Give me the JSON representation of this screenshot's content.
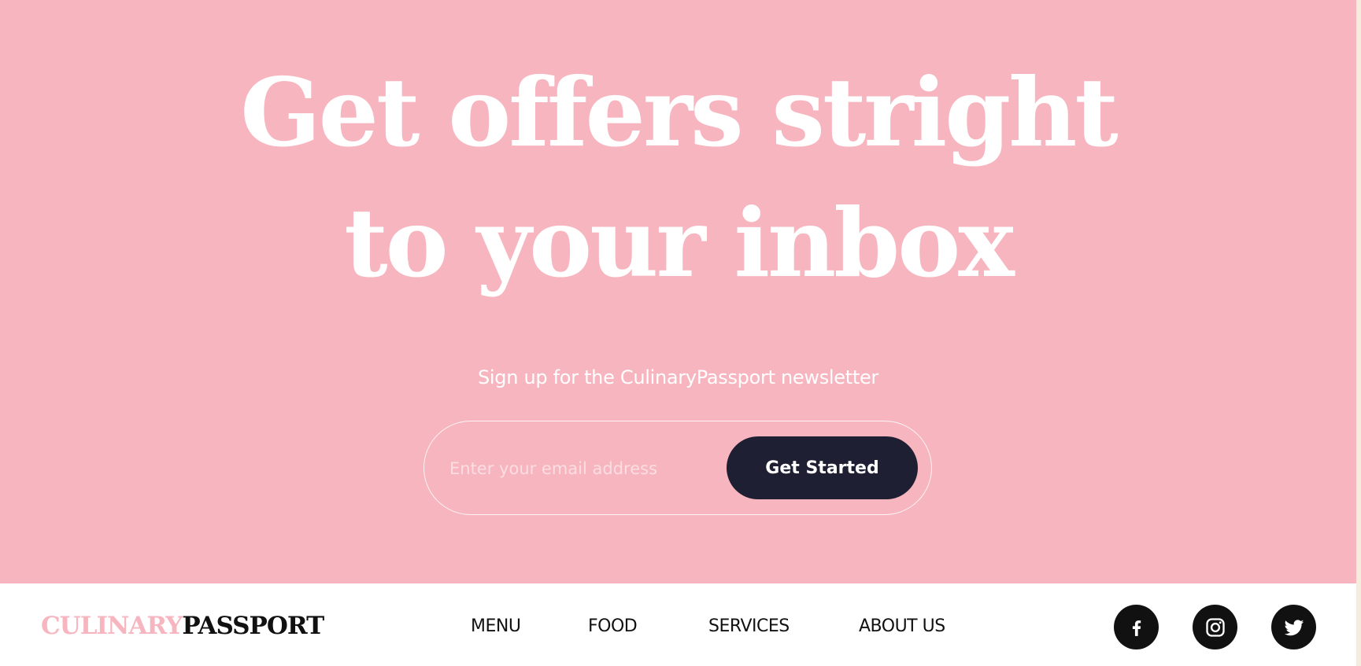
{
  "hero": {
    "headline_line1": "Get offers stright",
    "headline_line2": "to your inbox",
    "subtitle": "Sign up for the CulinaryPassport newsletter",
    "email_placeholder": "Enter your email address",
    "cta_label": "Get Started"
  },
  "footer": {
    "logo_part1": "CULINARY",
    "logo_part2": "PASSPORT",
    "nav": [
      {
        "label": "MENU"
      },
      {
        "label": "FOOD"
      },
      {
        "label": "SERVICES"
      },
      {
        "label": "ABOUT US"
      }
    ],
    "social": [
      {
        "icon": "facebook-icon"
      },
      {
        "icon": "instagram-icon"
      },
      {
        "icon": "twitter-icon"
      }
    ]
  },
  "colors": {
    "hero_bg": "#f7b5bf",
    "button_bg": "#1f1f33",
    "logo_accent": "#f7b5bf",
    "footer_bg": "#ffffff",
    "text_dark": "#111111"
  }
}
